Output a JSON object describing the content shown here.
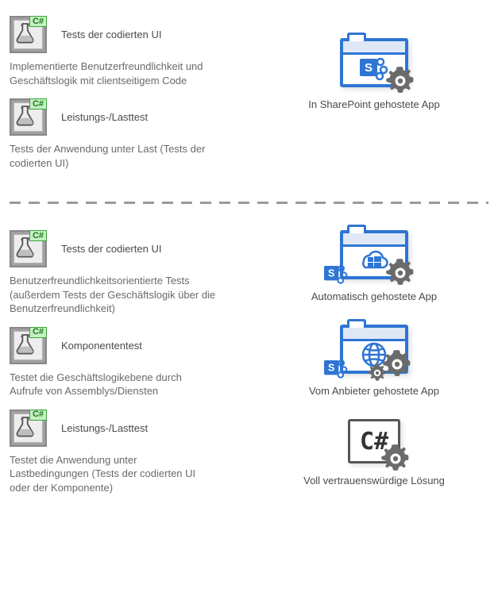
{
  "top": {
    "tests": [
      {
        "title": "Tests der codierten UI",
        "desc": "Implementierte Benutzerfreundlichkeit und Geschäftslogik mit clientseitigem Code"
      },
      {
        "title": "Leistungs-/Lasttest",
        "desc": "Tests der Anwendung unter Last (Tests der codierten UI)"
      }
    ],
    "app": {
      "label": "In SharePoint gehostete App"
    }
  },
  "bottom": {
    "tests": [
      {
        "title": "Tests der codierten UI",
        "desc": "Benutzerfreundlichkeitsorientierte Tests (außerdem Tests der Geschäftslogik über die Benutzerfreundlichkeit)"
      },
      {
        "title": "Komponententest",
        "desc": "Testet die Geschäftslogikebene durch Aufrufe von Assemblys/Diensten"
      },
      {
        "title": "Leistungs-/Lasttest",
        "desc": "Testet die Anwendung unter Lastbedingungen (Tests der codierten UI oder der Komponente)"
      }
    ],
    "apps": [
      {
        "label": "Automatisch gehostete App"
      },
      {
        "label": "Vom Anbieter gehostete App"
      },
      {
        "label": "Voll vertrauenswürdige Lösung"
      }
    ]
  },
  "csharp_badge": "C#"
}
